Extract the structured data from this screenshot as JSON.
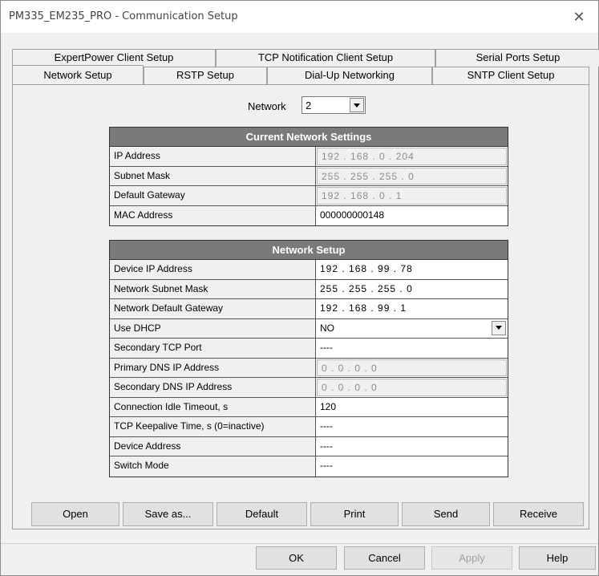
{
  "window": {
    "title": "PM335_EM235_PRO - Communication Setup",
    "close_icon": "close-icon"
  },
  "tabs": {
    "back_row": [
      {
        "label": "ExpertPower Client Setup"
      },
      {
        "label": "TCP Notification Client Setup"
      },
      {
        "label": "Serial Ports Setup"
      }
    ],
    "front_row": [
      {
        "label": "Network Setup",
        "active": true
      },
      {
        "label": "RSTP Setup"
      },
      {
        "label": "Dial-Up Networking"
      },
      {
        "label": "SNTP Client Setup"
      }
    ]
  },
  "network_selector": {
    "label": "Network",
    "value": "2"
  },
  "current_settings": {
    "header": "Current Network Settings",
    "rows": [
      {
        "label": "IP Address",
        "value": "192 . 168 .  0  . 204"
      },
      {
        "label": "Subnet Mask",
        "value": "255 . 255 . 255 .  0"
      },
      {
        "label": "Default Gateway",
        "value": "192 . 168 .  0  .  1"
      },
      {
        "label": "MAC Address",
        "value": "000000000148"
      }
    ]
  },
  "network_setup": {
    "header": "Network Setup",
    "rows": [
      {
        "label": "Device IP Address",
        "value": "192 . 168 . 99 . 78"
      },
      {
        "label": "Network Subnet Mask",
        "value": "255 . 255 . 255 . 0"
      },
      {
        "label": "Network Default Gateway",
        "value": "192 . 168 . 99 . 1"
      },
      {
        "label": "Use DHCP",
        "value": "NO"
      },
      {
        "label": "Secondary TCP Port",
        "value": "----"
      },
      {
        "label": "Primary DNS IP Address",
        "value": "0 . 0 . 0 . 0"
      },
      {
        "label": "Secondary DNS IP Address",
        "value": "0 . 0 . 0 . 0"
      },
      {
        "label": "Connection Idle Timeout, s",
        "value": "120"
      },
      {
        "label": "TCP Keepalive Time, s (0=inactive)",
        "value": "----"
      },
      {
        "label": "Device Address",
        "value": "----"
      },
      {
        "label": "Switch Mode",
        "value": "----"
      }
    ]
  },
  "action_buttons": {
    "open": "Open",
    "save_as": "Save as...",
    "default": "Default",
    "print": "Print",
    "send": "Send",
    "receive": "Receive"
  },
  "dialog_buttons": {
    "ok": "OK",
    "cancel": "Cancel",
    "apply": "Apply",
    "help": "Help"
  }
}
